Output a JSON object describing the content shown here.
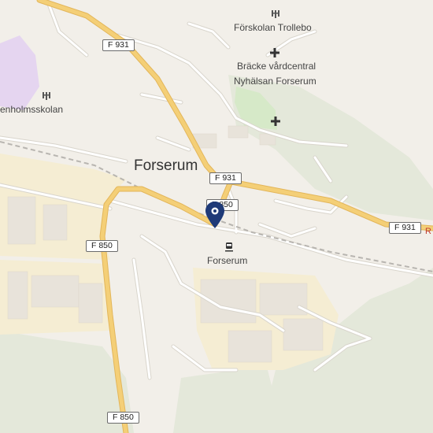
{
  "colors": {
    "background": "#f2efe9",
    "industrial": "#f5edd3",
    "forest": "#e4e8da",
    "park": "#d6e9c8",
    "school": "#e5d5f0",
    "major_road": "#f4cf77",
    "major_road_casing": "#e3b65a",
    "minor_road": "#ffffff",
    "minor_road_casing": "#d9d5cc",
    "railway": "#b8b5b0",
    "building": "#e8e3da",
    "marker": "#1f3a78"
  },
  "places": {
    "town": "Forserum",
    "station": "Forserum",
    "school_north": "Förskolan Trollebo",
    "health_center": "Bräcke vårdcentral",
    "clinic": "Nyhälsan Forserum",
    "school_west": "enholmsskolan"
  },
  "icons": {
    "school": "school-icon",
    "health": "cross-icon",
    "station": "train-icon",
    "marker": "location-pin-icon"
  },
  "roads": {
    "f931_north": "F 931",
    "f931_center": "F 931",
    "f931_east": "F 931",
    "f850_center": "F 850",
    "f850_west": "F 850",
    "f850_south": "F 850"
  },
  "edge_label": "R"
}
